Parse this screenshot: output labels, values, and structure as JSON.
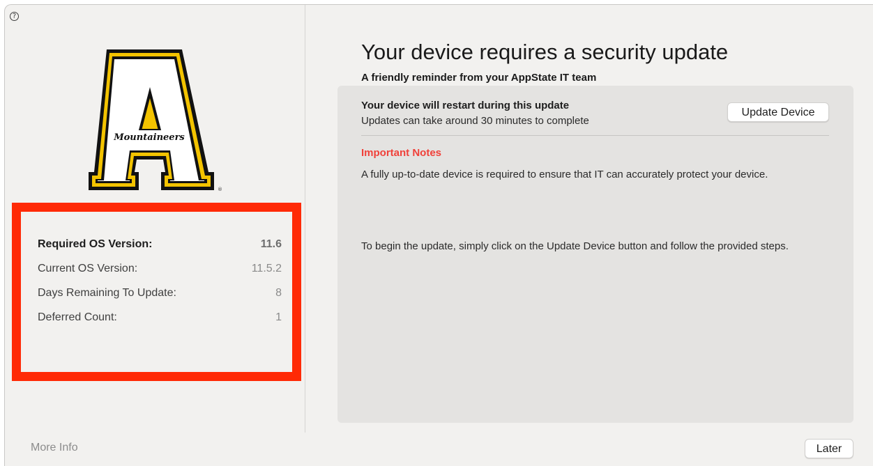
{
  "header": {
    "help_icon": "question-circle-icon",
    "help_glyph": "?"
  },
  "sidebar": {
    "logo": {
      "letter": "A",
      "wordmark": "Mountaineers",
      "registered": "®",
      "colors": {
        "gold": "#f3c300",
        "black": "#111111",
        "white": "#ffffff"
      }
    },
    "info": {
      "highlight_color": "#ff2a06",
      "rows": [
        {
          "label": "Required OS Version:",
          "value": "11.6",
          "bold": true
        },
        {
          "label": "Current OS Version:",
          "value": "11.5.2"
        },
        {
          "label": "Days Remaining To Update:",
          "value": "8"
        },
        {
          "label": "Deferred Count:",
          "value": "1"
        }
      ]
    },
    "more_info_label": "More Info"
  },
  "main": {
    "title": "Your device requires a security update",
    "subtitle": "A friendly reminder from your AppState IT team",
    "panel": {
      "restart_title": "Your device will restart during this update",
      "restart_sub": "Updates can take around 30 minutes to complete",
      "update_button": "Update Device",
      "notes_title": "Important Notes",
      "notes_color": "#f0413a",
      "paragraph1": "A fully up-to-date device is required to ensure that IT can accurately protect your device.",
      "paragraph2": "To begin the update, simply click on the Update Device button and follow the provided steps."
    },
    "later_button": "Later"
  }
}
